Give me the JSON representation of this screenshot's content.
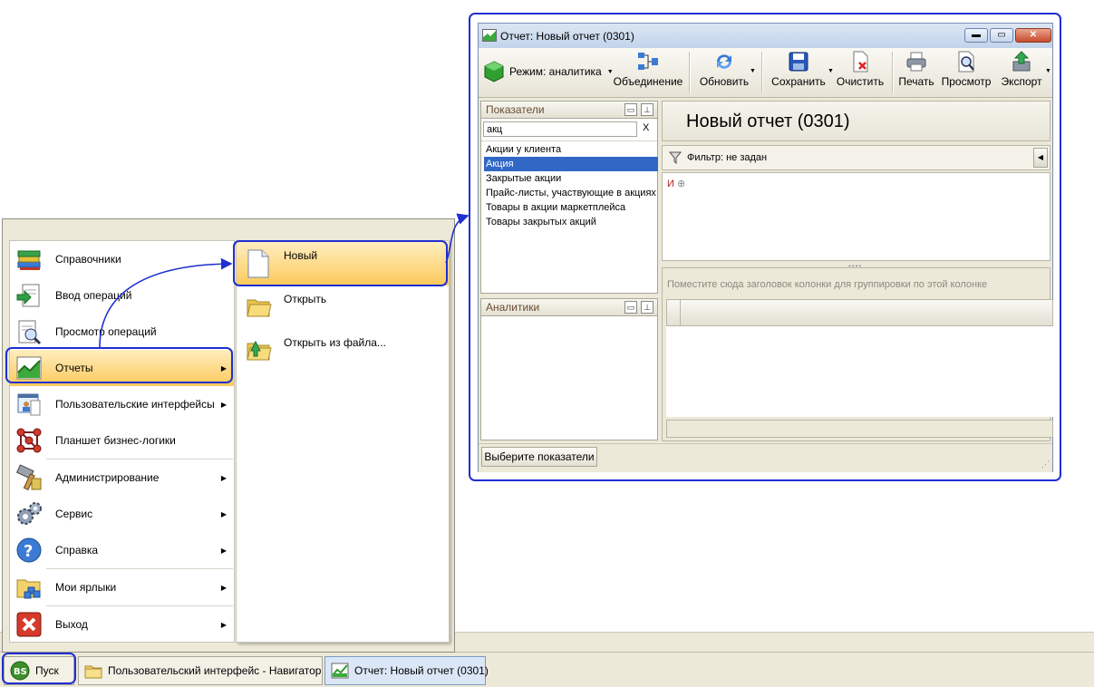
{
  "start_menu": {
    "items": [
      {
        "label": "Справочники",
        "icon": "books-icon",
        "has_submenu": false
      },
      {
        "label": "Ввод операций",
        "icon": "document-input-icon",
        "has_submenu": false
      },
      {
        "label": "Просмотр операций",
        "icon": "document-view-icon",
        "has_submenu": false
      },
      {
        "label": "Отчеты",
        "icon": "chart-icon",
        "has_submenu": true,
        "selected": true
      },
      {
        "label": "Пользовательские интерфейсы",
        "icon": "user-interface-icon",
        "has_submenu": true
      },
      {
        "label": "Планшет бизнес-логики",
        "icon": "molecule-icon",
        "has_submenu": false
      },
      {
        "label": "Администрирование",
        "icon": "admin-hammer-icon",
        "has_submenu": true
      },
      {
        "label": "Сервис",
        "icon": "gears-icon",
        "has_submenu": true
      },
      {
        "label": "Справка",
        "icon": "help-icon",
        "has_submenu": true
      },
      {
        "label": "Мои ярлыки",
        "icon": "shortcuts-icon",
        "has_submenu": true
      },
      {
        "label": "Выход",
        "icon": "exit-icon",
        "has_submenu": true
      }
    ],
    "submenu": [
      {
        "label": "Новый",
        "icon": "new-document-icon",
        "selected": true
      },
      {
        "label": "Открыть",
        "icon": "open-folder-icon"
      },
      {
        "label": "Открыть из файла...",
        "icon": "open-file-icon"
      }
    ]
  },
  "taskbar": {
    "start_label": "Пуск",
    "tasks": [
      {
        "label": "Пользовательский интерфейс - Навигатор",
        "icon": "folder-icon"
      },
      {
        "label": "Отчет: Новый отчет (0301)",
        "icon": "chart-icon",
        "active": true
      }
    ]
  },
  "report_window": {
    "title": "Отчет: Новый отчет (0301)",
    "toolbar": {
      "mode_label": "Режим: аналитика",
      "buttons": [
        {
          "label": "Объединение",
          "icon": "merge-icon"
        },
        {
          "label": "Обновить",
          "icon": "refresh-icon"
        },
        {
          "label": "Сохранить",
          "icon": "save-icon"
        },
        {
          "label": "Очистить",
          "icon": "clear-icon"
        },
        {
          "label": "Печать",
          "icon": "print-icon"
        },
        {
          "label": "Просмотр",
          "icon": "preview-icon"
        },
        {
          "label": "Экспорт",
          "icon": "export-icon"
        }
      ]
    },
    "indicators_pane": {
      "title": "Показатели",
      "search_value": "акц",
      "clear_label": "X",
      "items": [
        {
          "label": "Акции у клиента",
          "selected": false
        },
        {
          "label": "Акция",
          "selected": true
        },
        {
          "label": "Закрытые акции",
          "selected": false
        },
        {
          "label": "Прайс-листы, участвующие в акциях",
          "selected": false
        },
        {
          "label": "Товары в акции маркетплейса",
          "selected": false
        },
        {
          "label": "Товары закрытых акций",
          "selected": false
        }
      ]
    },
    "analytics_pane": {
      "title": "Аналитики"
    },
    "select_button": "Выберите показатели",
    "report_title": "Новый отчет (0301)",
    "filter_label": "Фильтр: не задан",
    "condition_label": "И",
    "group_hint": "Поместите сюда заголовок колонки для группировки по этой колонке"
  },
  "colors": {
    "highlight_outline": "#1f2fd0",
    "menu_selection": "#fcc95a",
    "list_selection": "#3168c6"
  }
}
